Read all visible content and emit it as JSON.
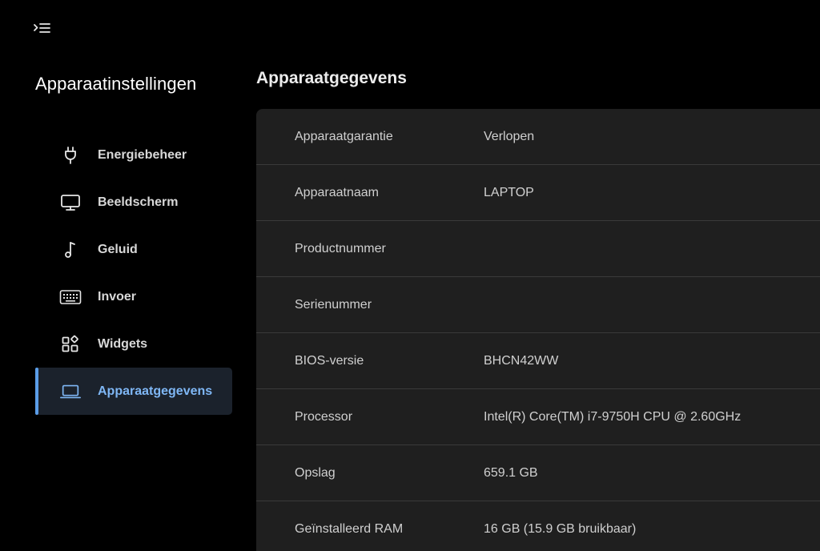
{
  "colors": {
    "background": "#000000",
    "panel": "#1f1f1f",
    "accent": "#5a9de8",
    "active_item_bg": "#1b222c",
    "active_text": "#7fb7f5",
    "divider": "#3a3a3a"
  },
  "header": {
    "menu_icon": "collapse-menu-icon"
  },
  "sidebar": {
    "title": "Apparaatinstellingen",
    "items": [
      {
        "label": "Energiebeheer",
        "icon": "power-plug-icon",
        "active": false
      },
      {
        "label": "Beeldscherm",
        "icon": "monitor-icon",
        "active": false
      },
      {
        "label": "Geluid",
        "icon": "music-note-icon",
        "active": false
      },
      {
        "label": "Invoer",
        "icon": "keyboard-icon",
        "active": false
      },
      {
        "label": "Widgets",
        "icon": "widgets-icon",
        "active": false
      },
      {
        "label": "Apparaatgegevens",
        "icon": "laptop-icon",
        "active": true
      }
    ]
  },
  "main": {
    "title": "Apparaatgegevens",
    "rows": [
      {
        "key": "Apparaatgarantie",
        "value": "Verlopen"
      },
      {
        "key": "Apparaatnaam",
        "value": "LAPTOP"
      },
      {
        "key": "Productnummer",
        "value": ""
      },
      {
        "key": "Serienummer",
        "value": ""
      },
      {
        "key": "BIOS-versie",
        "value": "BHCN42WW"
      },
      {
        "key": "Processor",
        "value": "Intel(R) Core(TM) i7-9750H CPU @ 2.60GHz"
      },
      {
        "key": "Opslag",
        "value": "659.1 GB"
      },
      {
        "key": "Geïnstalleerd RAM",
        "value": "16 GB (15.9 GB bruikbaar)"
      }
    ]
  }
}
